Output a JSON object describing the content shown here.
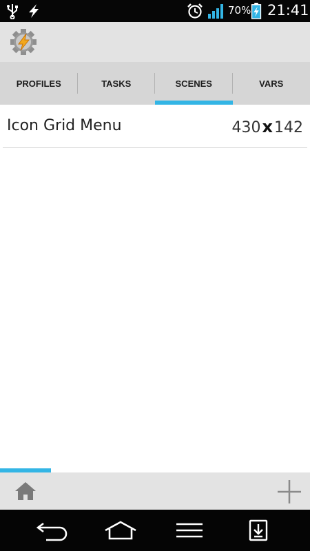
{
  "status_bar": {
    "icons": [
      "usb-icon",
      "charging-bolt-icon",
      "alarm-clock-icon",
      "signal-bars-icon",
      "battery-charging-icon"
    ],
    "battery_percent": "70%",
    "time": "21:41"
  },
  "app": {
    "icon": "tasker-gear-bolt-icon"
  },
  "tabs": [
    {
      "label": "PROFILES",
      "selected": false
    },
    {
      "label": "TASKS",
      "selected": false
    },
    {
      "label": "SCENES",
      "selected": true
    },
    {
      "label": "VARS",
      "selected": false
    }
  ],
  "scenes": [
    {
      "name": "Icon Grid Menu",
      "width": "430",
      "separator": "x",
      "height": "142"
    }
  ],
  "progress": {
    "fraction": 0.165
  },
  "bottom_bar": {
    "left_icon": "home-icon",
    "right_icon": "plus-icon"
  },
  "nav_bar": {
    "icons": [
      "back-icon",
      "home-outline-icon",
      "menu-icon",
      "download-notification-icon"
    ]
  },
  "colors": {
    "accent": "#33b5e5",
    "tab_bar": "#d6d6d6",
    "action_bar": "#e3e3e3",
    "status_bar": "#060606"
  }
}
